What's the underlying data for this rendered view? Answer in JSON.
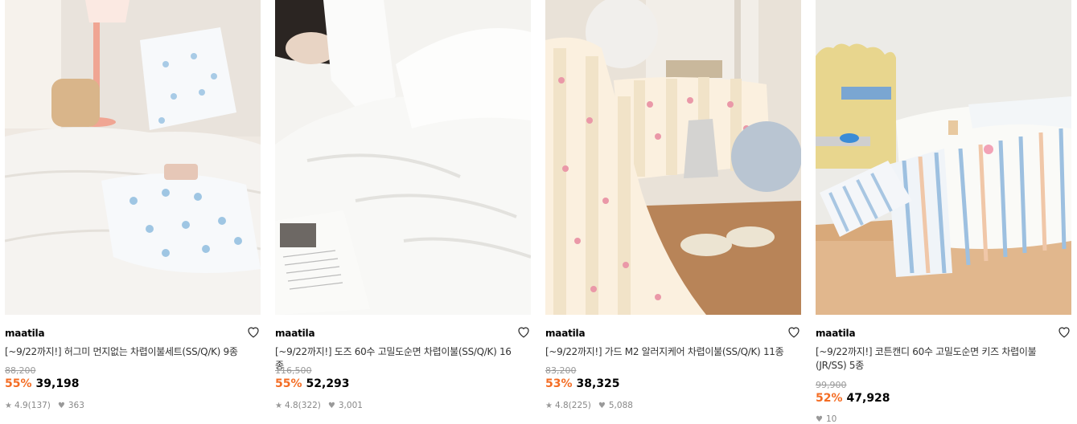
{
  "products": [
    {
      "brand": "maatila",
      "title": "[~9/22까지!] 허그미 먼지없는 차렵이불세트(SS/Q/K) 9종",
      "original_price": "88,200",
      "discount": "55%",
      "price": "39,198",
      "rating": "4.9",
      "reviews": "(137)",
      "likes": "363"
    },
    {
      "brand": "maatila",
      "title": "[~9/22까지!] 도즈 60수 고밀도순면 차렵이불(SS/Q/K) 16종",
      "original_price": "116,500",
      "discount": "55%",
      "price": "52,293",
      "rating": "4.8",
      "reviews": "(322)",
      "likes": "3,001"
    },
    {
      "brand": "maatila",
      "title": "[~9/22까지!] 가드 M2 알러지케어 차렵이불(SS/Q/K) 11종",
      "original_price": "83,200",
      "discount": "53%",
      "price": "38,325",
      "rating": "4.8",
      "reviews": "(225)",
      "likes": "5,088"
    },
    {
      "brand": "maatila",
      "title": "[~9/22까지!] 코튼캔디 60수 고밀도순면 키즈 차렵이불(JR/SS) 5종",
      "original_price": "99,900",
      "discount": "52%",
      "price": "47,928",
      "likes": "10"
    }
  ]
}
